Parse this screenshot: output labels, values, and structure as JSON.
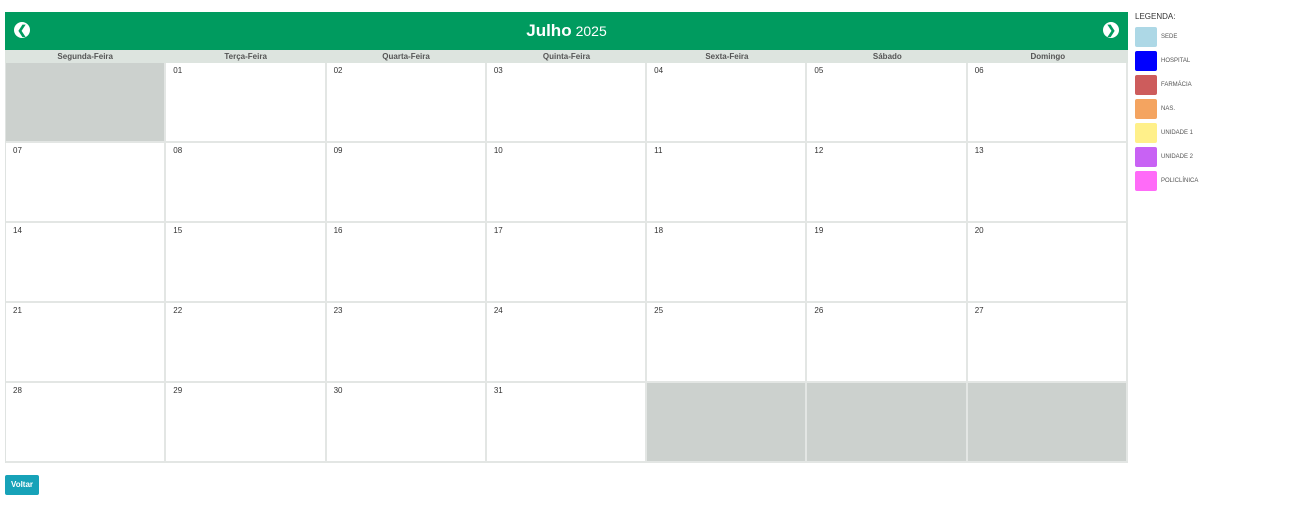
{
  "header": {
    "month": "Julho",
    "year": "2025"
  },
  "weekdays": [
    "Segunda-Feira",
    "Terça-Feira",
    "Quarta-Feira",
    "Quinta-Feira",
    "Sexta-Feira",
    "Sábado",
    "Domingo"
  ],
  "days": [
    "",
    "01",
    "02",
    "03",
    "04",
    "05",
    "06",
    "07",
    "08",
    "09",
    "10",
    "11",
    "12",
    "13",
    "14",
    "15",
    "16",
    "17",
    "18",
    "19",
    "20",
    "21",
    "22",
    "23",
    "24",
    "25",
    "26",
    "27",
    "28",
    "29",
    "30",
    "31",
    "",
    "",
    ""
  ],
  "legend": {
    "title": "LEGENDA:",
    "items": [
      {
        "label": "SEDE",
        "color": "#add8e6"
      },
      {
        "label": "HOSPITAL",
        "color": "#0000ff"
      },
      {
        "label": "FARMÁCIA",
        "color": "#cd5c5c"
      },
      {
        "label": "NAS.",
        "color": "#f4a460"
      },
      {
        "label": "UNIDADE 1",
        "color": "#fff08a"
      },
      {
        "label": "UNIDADE 2",
        "color": "#c862f4"
      },
      {
        "label": "POLICLÍNICA",
        "color": "#ff6bf8"
      }
    ]
  },
  "actions": {
    "back_label": "Voltar"
  }
}
